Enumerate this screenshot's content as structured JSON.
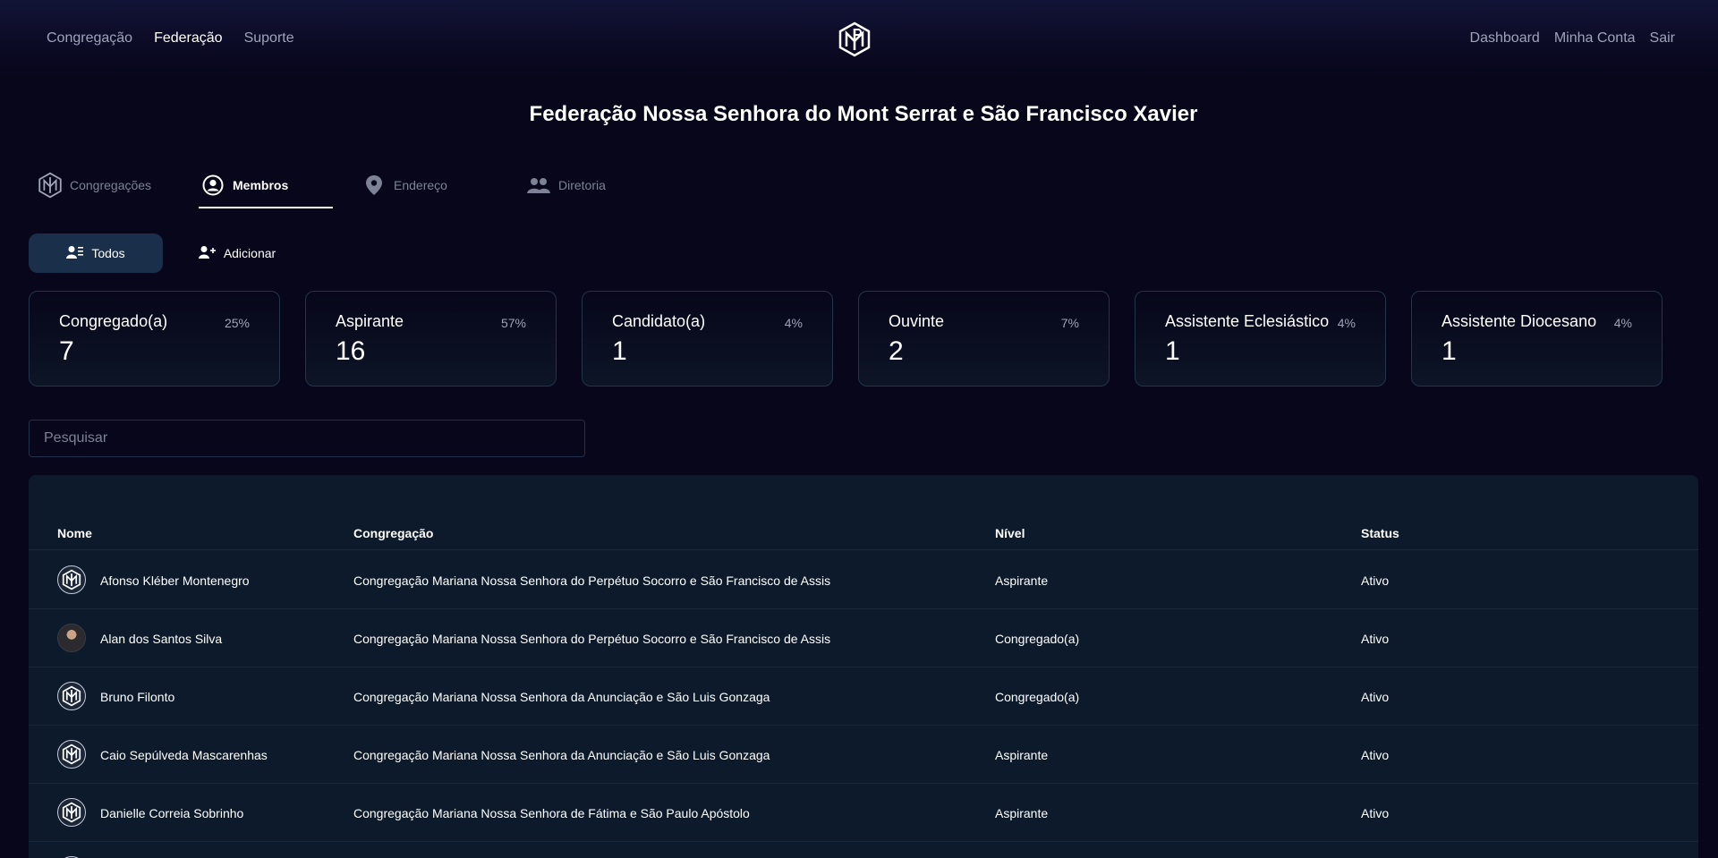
{
  "nav": {
    "left": [
      "Congregação",
      "Federação",
      "Suporte"
    ],
    "active": "Federação",
    "right": [
      "Dashboard",
      "Minha Conta",
      "Sair"
    ]
  },
  "page": {
    "title": "Federação Nossa Senhora do Mont Serrat e São Francisco Xavier"
  },
  "tabs": [
    {
      "label": "Congregações",
      "icon": "logo-icon"
    },
    {
      "label": "Membros",
      "icon": "user-circle-icon",
      "active": true
    },
    {
      "label": "Endereço",
      "icon": "map-pin-icon"
    },
    {
      "label": "Diretoria",
      "icon": "users-icon"
    }
  ],
  "subtabs": [
    {
      "label": "Todos",
      "icon": "user-list-icon",
      "active": true
    },
    {
      "label": "Adicionar",
      "icon": "user-plus-icon"
    }
  ],
  "stats": [
    {
      "label": "Congregado(a)",
      "percent": "25%",
      "value": "7"
    },
    {
      "label": "Aspirante",
      "percent": "57%",
      "value": "16"
    },
    {
      "label": "Candidato(a)",
      "percent": "4%",
      "value": "1"
    },
    {
      "label": "Ouvinte",
      "percent": "7%",
      "value": "2"
    },
    {
      "label": "Assistente Eclesiástico",
      "percent": "4%",
      "value": "1"
    },
    {
      "label": "Assistente Diocesano",
      "percent": "4%",
      "value": "1"
    }
  ],
  "search": {
    "placeholder": "Pesquisar"
  },
  "table": {
    "headers": {
      "name": "Nome",
      "congregation": "Congregação",
      "level": "Nível",
      "status": "Status"
    },
    "rows": [
      {
        "name": "Afonso Kléber Montenegro",
        "congregation": "Congregação Mariana Nossa Senhora do Perpétuo Socorro e São Francisco de Assis",
        "level": "Aspirante",
        "status": "Ativo",
        "avatar": "logo"
      },
      {
        "name": "Alan dos Santos Silva",
        "congregation": "Congregação Mariana Nossa Senhora do Perpétuo Socorro e São Francisco de Assis",
        "level": "Congregado(a)",
        "status": "Ativo",
        "avatar": "photo"
      },
      {
        "name": "Bruno Filonto",
        "congregation": "Congregação Mariana Nossa Senhora da Anunciação e São Luis Gonzaga",
        "level": "Congregado(a)",
        "status": "Ativo",
        "avatar": "logo"
      },
      {
        "name": "Caio Sepúlveda Mascarenhas",
        "congregation": "Congregação Mariana Nossa Senhora da Anunciação e São Luis Gonzaga",
        "level": "Aspirante",
        "status": "Ativo",
        "avatar": "logo"
      },
      {
        "name": "Danielle Correia Sobrinho",
        "congregation": "Congregação Mariana Nossa Senhora de Fátima e São Paulo Apóstolo",
        "level": "Aspirante",
        "status": "Ativo",
        "avatar": "logo"
      }
    ]
  },
  "colors": {
    "background": "#07061a",
    "panel": "#0d1a2b",
    "accent": "#1a2f4a",
    "card_border": "#23354a"
  }
}
